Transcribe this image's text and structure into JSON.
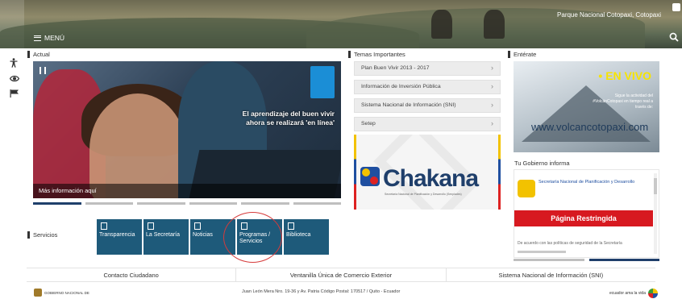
{
  "header": {
    "location": "Parque Nacional Cotopaxi, Cotopaxi",
    "menu_label": "MENÚ",
    "search_icon": "search-icon"
  },
  "side_icons": [
    "accessibility-icon",
    "eye-icon",
    "flag-icon"
  ],
  "actual": {
    "title": "Actual",
    "caption": "El aprendizaje del buen vivir ahora se realizará 'en línea'",
    "more_info": "Más información aquí",
    "slide_count": 6,
    "active_slide": 1
  },
  "temas": {
    "title": "Temas Importantes",
    "items": [
      "Plan Buen Vivir 2013 - 2017",
      "Información de Inversión Pública",
      "Sistema Nacional de Información (SNI)",
      "Setep"
    ],
    "chakana_word": "Chakana",
    "chakana_sub": "Secretaría Nacional de Planificación y Desarrollo (Senplades)"
  },
  "enterate": {
    "title": "Entérate",
    "live_label": "• EN VIVO",
    "live_text": "Sigue la actividad del #VolcánCotopaxi en tiempo real a través de:",
    "url": "www.volcancotopaxi.com"
  },
  "gobierno": {
    "title": "Tu Gobierno informa",
    "senplades": "Secretaría Nacional de Planificación y Desarrollo",
    "restricted": "Página Restringida",
    "note": "De acuerdo con las políticas de seguridad de la Secretaría"
  },
  "servicios": {
    "title": "Servicios",
    "tiles": [
      {
        "label": "Transparencia",
        "icon": "eye-icon"
      },
      {
        "label": "La Secretaría",
        "icon": "building-icon"
      },
      {
        "label": "Noticias",
        "icon": "news-icon"
      },
      {
        "label": "Programas / Servicios",
        "icon": "monitor-icon"
      },
      {
        "label": "Biblioteca",
        "icon": "book-icon"
      }
    ]
  },
  "footer": {
    "links": [
      "Contacto Ciudadano",
      "Ventanilla Única de Comercio Exterior",
      "Sistema Nacional de Información (SNI)"
    ],
    "address": "Juan León Mera Nro. 19-36 y Av. Patria Código Postal: 170517 / Quito - Ecuador",
    "gob_label": "GOBIERNO NACIONAL DE",
    "ecuador_label": "ecuador ama la vida"
  },
  "colors": {
    "tile_blue": "#1e5a7a",
    "restricted_red": "#d71920",
    "chakana_blue": "#1f3f6b",
    "live_yellow": "#f7e400"
  }
}
